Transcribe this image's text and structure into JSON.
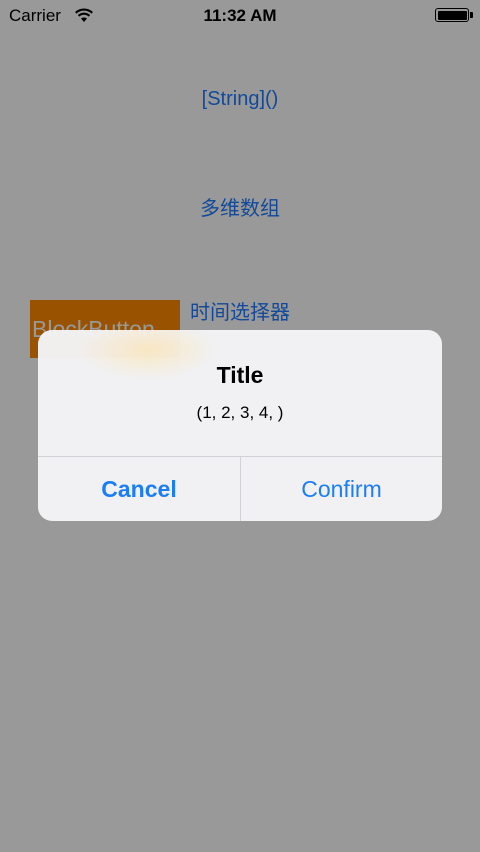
{
  "status_bar": {
    "carrier": "Carrier",
    "time": "11:32 AM"
  },
  "main": {
    "buttons": [
      "[String]()",
      "多维数组",
      "时间选择器"
    ],
    "block_button_label": "BlockButton"
  },
  "alert": {
    "title": "Title",
    "message": "(1, 2, 3, 4, )",
    "cancel_label": "Cancel",
    "confirm_label": "Confirm"
  },
  "colors": {
    "accent": "#1f7cff",
    "block_button_bg": "#ff8a00",
    "overlay": "rgba(0,0,0,0.4)"
  }
}
